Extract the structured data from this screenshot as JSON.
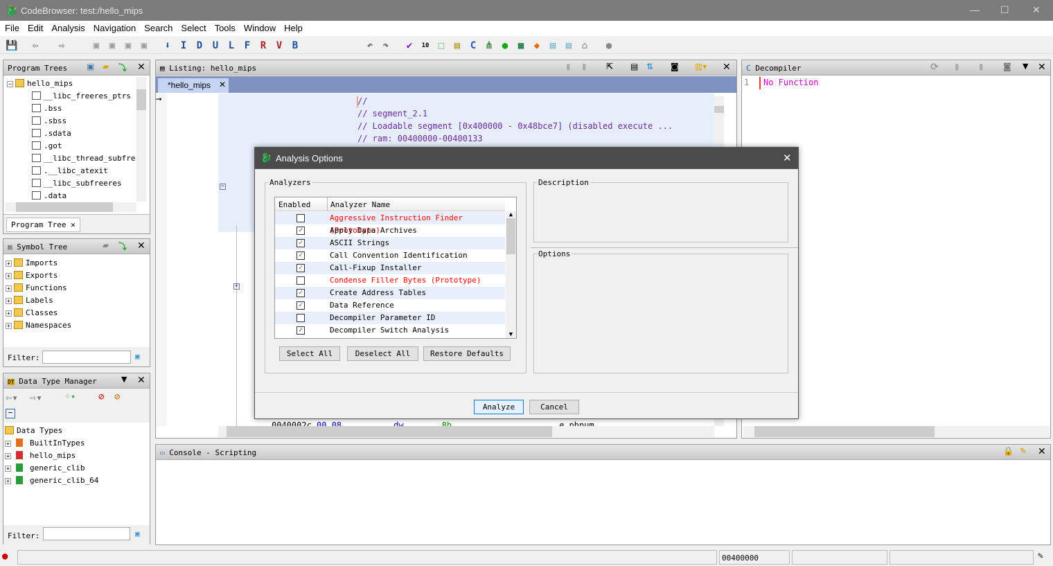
{
  "window": {
    "title": "CodeBrowser: test:/hello_mips",
    "controls": [
      "minimize",
      "maximize",
      "close"
    ]
  },
  "menu": [
    "File",
    "Edit",
    "Analysis",
    "Navigation",
    "Search",
    "Select",
    "Tools",
    "Window",
    "Help"
  ],
  "toolbar": {
    "letters": [
      "I",
      "D",
      "U",
      "L",
      "F",
      "R",
      "V",
      "B"
    ]
  },
  "program_trees": {
    "title": "Program Trees",
    "root": "hello_mips",
    "items": [
      "__libc_freeres_ptrs",
      ".bss",
      ".sbss",
      ".sdata",
      ".got",
      "__libc_thread_subfre",
      ".__libc_atexit",
      "__libc_subfreeres",
      ".data"
    ],
    "tab": "Program Tree"
  },
  "symbol_tree": {
    "title": "Symbol Tree",
    "items": [
      "Imports",
      "Exports",
      "Functions",
      "Labels",
      "Classes",
      "Namespaces"
    ],
    "filter_label": "Filter:",
    "filter_value": ""
  },
  "data_type_manager": {
    "title": "Data Type Manager",
    "root": "Data Types",
    "items": [
      "BuiltInTypes",
      "hello_mips",
      "generic_clib",
      "generic_clib_64"
    ],
    "filter_label": "Filter:",
    "filter_value": ""
  },
  "listing": {
    "title": "Listing:  hello_mips",
    "tab": "*hello_mips",
    "lines": [
      "//",
      "// segment_2.1",
      "// Loadable segment  [0x400000 - 0x48bce7] (disabled execute ...",
      "// ram: 00400000-00400133"
    ],
    "bottom_line": {
      "addr": "0040002c",
      "bytes": "00 08",
      "mnemonic": "dw",
      "operand": "8h",
      "label": "e_phnum"
    }
  },
  "decompiler": {
    "title": "Decompiler",
    "line_no": "1",
    "text": "No Function"
  },
  "console": {
    "title": "Console - Scripting"
  },
  "status": {
    "address": "00400000"
  },
  "dialog": {
    "title": "Analysis Options",
    "analyzers_label": "Analyzers",
    "columns": [
      "Enabled",
      "Analyzer Name"
    ],
    "analyzers": [
      {
        "name": "Aggressive Instruction Finder  (Prototype)",
        "enabled": false,
        "prototype": true
      },
      {
        "name": "Apply Data Archives",
        "enabled": true,
        "prototype": false
      },
      {
        "name": "ASCII Strings",
        "enabled": true,
        "prototype": false
      },
      {
        "name": "Call Convention Identification",
        "enabled": true,
        "prototype": false
      },
      {
        "name": "Call-Fixup Installer",
        "enabled": true,
        "prototype": false
      },
      {
        "name": "Condense Filler Bytes  (Prototype)",
        "enabled": false,
        "prototype": true
      },
      {
        "name": "Create Address Tables",
        "enabled": true,
        "prototype": false
      },
      {
        "name": "Data Reference",
        "enabled": true,
        "prototype": false
      },
      {
        "name": "Decompiler Parameter ID",
        "enabled": false,
        "prototype": false
      },
      {
        "name": "Decompiler Switch Analysis",
        "enabled": true,
        "prototype": false
      }
    ],
    "select_all": "Select All",
    "deselect_all": "Deselect All",
    "restore_defaults": "Restore Defaults",
    "description_label": "Description",
    "options_label": "Options",
    "analyze": "Analyze",
    "cancel": "Cancel",
    "colors": {
      "prototype": "#ff0000",
      "alt_row": "#e9effa"
    }
  }
}
